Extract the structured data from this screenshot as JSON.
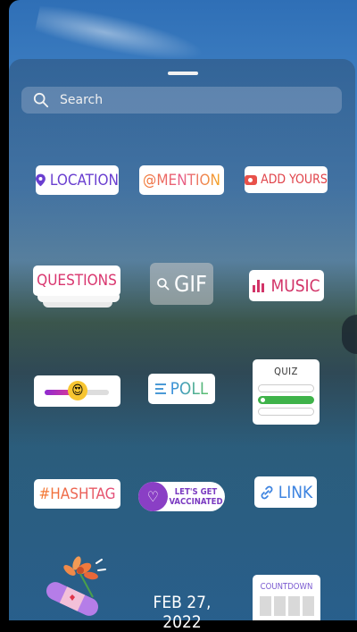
{
  "search": {
    "placeholder": "Search"
  },
  "stickers": {
    "location": "LOCATION",
    "mention": "@MENTION",
    "add_yours": "ADD YOURS",
    "questions": "QUESTIONS",
    "gif": "GIF",
    "music": "MUSIC",
    "slider_emoji": "😍",
    "poll": "POLL",
    "quiz": "QUIZ",
    "hashtag": "#HASHTAG",
    "vaccinated": "LET'S GET VACCINATED",
    "link": "LINK",
    "date": "FEB 27, 2022",
    "countdown": "COUNTDOWN"
  },
  "colors": {
    "location": "#6a3fd0",
    "music": "#d23468",
    "link": "#3e84e0",
    "vaccinated": "#8a3fc5"
  }
}
